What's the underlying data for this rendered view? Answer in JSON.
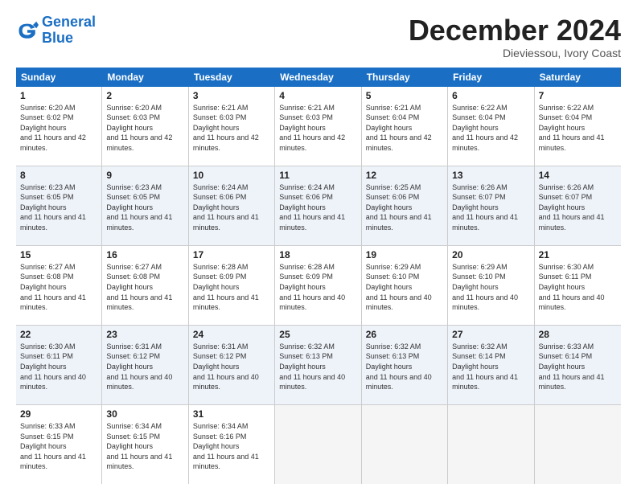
{
  "logo": {
    "line1": "General",
    "line2": "Blue"
  },
  "title": "December 2024",
  "subtitle": "Dieviessou, Ivory Coast",
  "days": [
    "Sunday",
    "Monday",
    "Tuesday",
    "Wednesday",
    "Thursday",
    "Friday",
    "Saturday"
  ],
  "weeks": [
    [
      {
        "num": "1",
        "rise": "6:20 AM",
        "set": "6:02 PM",
        "daylight": "11 hours and 42 minutes."
      },
      {
        "num": "2",
        "rise": "6:20 AM",
        "set": "6:03 PM",
        "daylight": "11 hours and 42 minutes."
      },
      {
        "num": "3",
        "rise": "6:21 AM",
        "set": "6:03 PM",
        "daylight": "11 hours and 42 minutes."
      },
      {
        "num": "4",
        "rise": "6:21 AM",
        "set": "6:03 PM",
        "daylight": "11 hours and 42 minutes."
      },
      {
        "num": "5",
        "rise": "6:21 AM",
        "set": "6:04 PM",
        "daylight": "11 hours and 42 minutes."
      },
      {
        "num": "6",
        "rise": "6:22 AM",
        "set": "6:04 PM",
        "daylight": "11 hours and 42 minutes."
      },
      {
        "num": "7",
        "rise": "6:22 AM",
        "set": "6:04 PM",
        "daylight": "11 hours and 41 minutes."
      }
    ],
    [
      {
        "num": "8",
        "rise": "6:23 AM",
        "set": "6:05 PM",
        "daylight": "11 hours and 41 minutes."
      },
      {
        "num": "9",
        "rise": "6:23 AM",
        "set": "6:05 PM",
        "daylight": "11 hours and 41 minutes."
      },
      {
        "num": "10",
        "rise": "6:24 AM",
        "set": "6:06 PM",
        "daylight": "11 hours and 41 minutes."
      },
      {
        "num": "11",
        "rise": "6:24 AM",
        "set": "6:06 PM",
        "daylight": "11 hours and 41 minutes."
      },
      {
        "num": "12",
        "rise": "6:25 AM",
        "set": "6:06 PM",
        "daylight": "11 hours and 41 minutes."
      },
      {
        "num": "13",
        "rise": "6:26 AM",
        "set": "6:07 PM",
        "daylight": "11 hours and 41 minutes."
      },
      {
        "num": "14",
        "rise": "6:26 AM",
        "set": "6:07 PM",
        "daylight": "11 hours and 41 minutes."
      }
    ],
    [
      {
        "num": "15",
        "rise": "6:27 AM",
        "set": "6:08 PM",
        "daylight": "11 hours and 41 minutes."
      },
      {
        "num": "16",
        "rise": "6:27 AM",
        "set": "6:08 PM",
        "daylight": "11 hours and 41 minutes."
      },
      {
        "num": "17",
        "rise": "6:28 AM",
        "set": "6:09 PM",
        "daylight": "11 hours and 41 minutes."
      },
      {
        "num": "18",
        "rise": "6:28 AM",
        "set": "6:09 PM",
        "daylight": "11 hours and 40 minutes."
      },
      {
        "num": "19",
        "rise": "6:29 AM",
        "set": "6:10 PM",
        "daylight": "11 hours and 40 minutes."
      },
      {
        "num": "20",
        "rise": "6:29 AM",
        "set": "6:10 PM",
        "daylight": "11 hours and 40 minutes."
      },
      {
        "num": "21",
        "rise": "6:30 AM",
        "set": "6:11 PM",
        "daylight": "11 hours and 40 minutes."
      }
    ],
    [
      {
        "num": "22",
        "rise": "6:30 AM",
        "set": "6:11 PM",
        "daylight": "11 hours and 40 minutes."
      },
      {
        "num": "23",
        "rise": "6:31 AM",
        "set": "6:12 PM",
        "daylight": "11 hours and 40 minutes."
      },
      {
        "num": "24",
        "rise": "6:31 AM",
        "set": "6:12 PM",
        "daylight": "11 hours and 40 minutes."
      },
      {
        "num": "25",
        "rise": "6:32 AM",
        "set": "6:13 PM",
        "daylight": "11 hours and 40 minutes."
      },
      {
        "num": "26",
        "rise": "6:32 AM",
        "set": "6:13 PM",
        "daylight": "11 hours and 40 minutes."
      },
      {
        "num": "27",
        "rise": "6:32 AM",
        "set": "6:14 PM",
        "daylight": "11 hours and 41 minutes."
      },
      {
        "num": "28",
        "rise": "6:33 AM",
        "set": "6:14 PM",
        "daylight": "11 hours and 41 minutes."
      }
    ],
    [
      {
        "num": "29",
        "rise": "6:33 AM",
        "set": "6:15 PM",
        "daylight": "11 hours and 41 minutes."
      },
      {
        "num": "30",
        "rise": "6:34 AM",
        "set": "6:15 PM",
        "daylight": "11 hours and 41 minutes."
      },
      {
        "num": "31",
        "rise": "6:34 AM",
        "set": "6:16 PM",
        "daylight": "11 hours and 41 minutes."
      },
      null,
      null,
      null,
      null
    ]
  ]
}
